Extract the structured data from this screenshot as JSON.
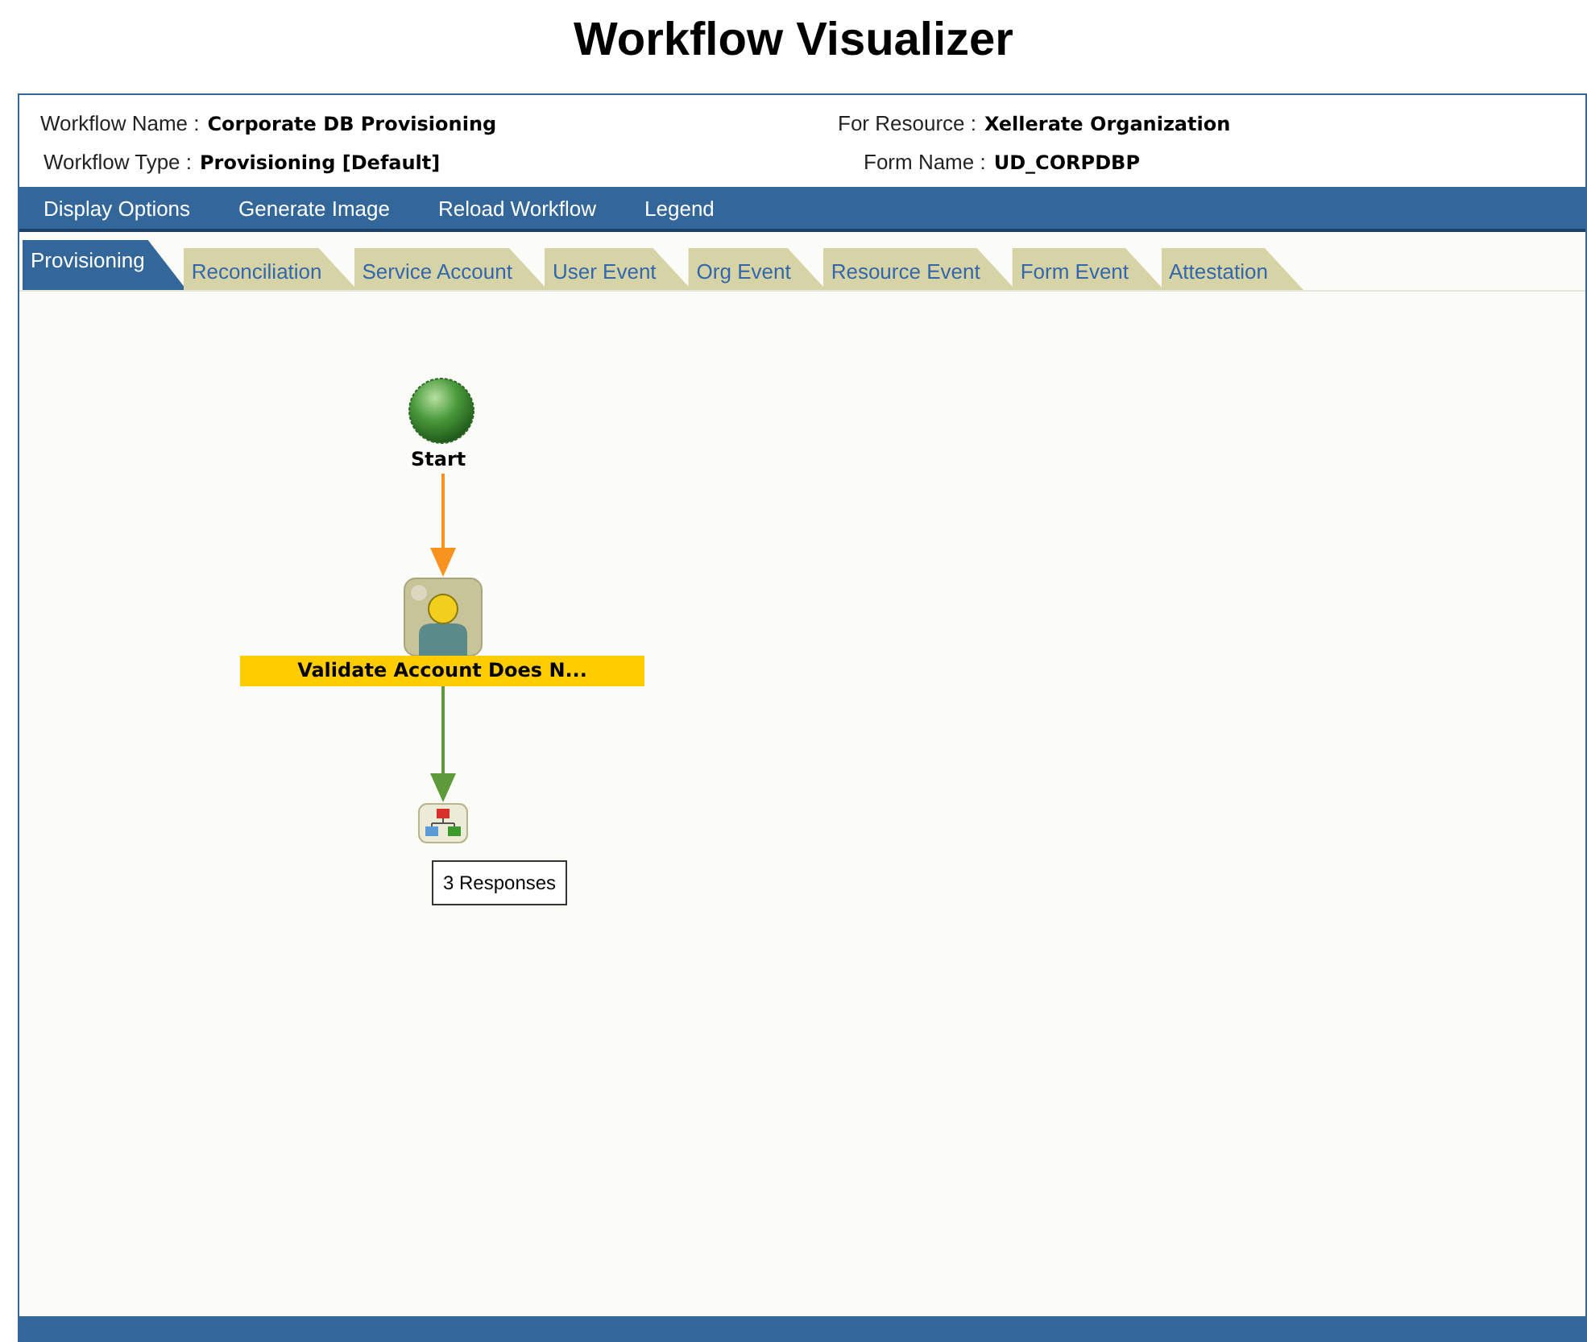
{
  "title": "Workflow Visualizer",
  "fields": [
    {
      "label": "Workflow Name :",
      "value": "Corporate DB Provisioning"
    },
    {
      "label": "For Resource :",
      "value": "Xellerate Organization"
    },
    {
      "label": "Workflow Type :",
      "value": "Provisioning [Default]"
    },
    {
      "label": "Form Name :",
      "value": "UD_CORPDBP"
    }
  ],
  "menu": [
    "Display Options",
    "Generate Image",
    "Reload Workflow",
    "Legend"
  ],
  "tabs": [
    {
      "label": "Provisioning",
      "selected": true
    },
    {
      "label": "Reconciliation",
      "selected": false
    },
    {
      "label": "Service Account",
      "selected": false
    },
    {
      "label": "User Event",
      "selected": false
    },
    {
      "label": "Org Event",
      "selected": false
    },
    {
      "label": "Resource Event",
      "selected": false
    },
    {
      "label": "Form Event",
      "selected": false
    },
    {
      "label": "Attestation",
      "selected": false
    }
  ],
  "diagram": {
    "start": "Start",
    "task": "Validate Account Does N...",
    "responses": "3 Responses"
  }
}
